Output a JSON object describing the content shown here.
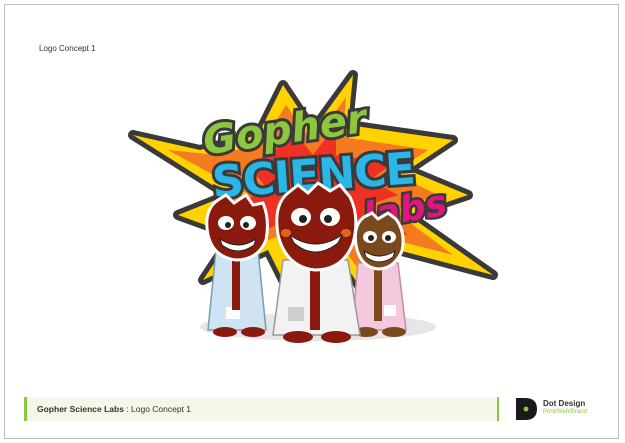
{
  "page": {
    "concept_label": "Logo Concept 1"
  },
  "logo": {
    "word_top": "Gopher",
    "word_middle": "SCIENCE",
    "word_bottom": "labs",
    "colors": {
      "green": "#8dc63f",
      "cyan": "#2ab6e6",
      "pink": "#e2157f",
      "burst_orange": "#f47b20",
      "burst_yellow": "#ffd200",
      "burst_red": "#ee3124",
      "outline": "#3a3a3a",
      "gopher_dark": "#8b1a0e",
      "gopher_brown": "#7a4a1e"
    }
  },
  "footer": {
    "title": "Gopher Science Labs",
    "separator": " : ",
    "subtitle": "Logo Concept 1",
    "accent": "#8dc63f"
  },
  "brand": {
    "name": "Dot Design",
    "tagline": "Print/Web/Brand"
  }
}
